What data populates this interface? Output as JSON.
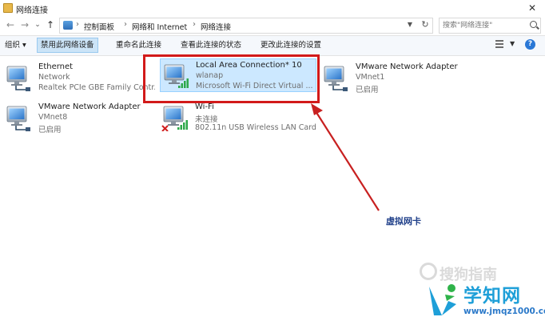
{
  "window": {
    "title": "网络连接"
  },
  "nav": {
    "back": "←",
    "forward": "→",
    "dropdown": "⌄",
    "up": "↑"
  },
  "breadcrumb": [
    "控制面板",
    "网络和 Internet",
    "网络连接"
  ],
  "breadcrumb_separator": "›",
  "search": {
    "placeholder": "搜索\"网络连接\""
  },
  "toolbar": {
    "organize": "组织 ▾",
    "disable": "禁用此网络设备",
    "rename": "重命名此连接",
    "view_status": "查看此连接的状态",
    "change_settings": "更改此连接的设置",
    "help": "?"
  },
  "connections": [
    {
      "name": "Ethernet",
      "status": "Network",
      "device": "Realtek PCIe GBE Family Contr...",
      "icon": "network-adapter-icon"
    },
    {
      "name": "Local Area Connection* 10",
      "status": "wlanap",
      "device": "Microsoft Wi-Fi Direct Virtual ...",
      "icon": "wifi-adapter-icon"
    },
    {
      "name": "VMware Network Adapter",
      "status": "VMnet1",
      "device": "已启用",
      "icon": "network-adapter-icon"
    },
    {
      "name": "VMware Network Adapter",
      "status": "VMnet8",
      "device": "已启用",
      "icon": "network-adapter-icon"
    },
    {
      "name": "Wi-Fi",
      "status": "未连接",
      "device": "802.11n USB Wireless LAN Card",
      "icon": "wifi-disconnected-icon"
    }
  ],
  "annotation": {
    "label": "虚拟网卡"
  },
  "watermark": {
    "sogou": "搜狗指南",
    "site": "学知网",
    "url": "www.jmqz1000.com"
  },
  "colors": {
    "highlight": "#d21a1a",
    "arrow": "#c82020",
    "selection": "#cce8ff",
    "annotation": "#20408a"
  }
}
